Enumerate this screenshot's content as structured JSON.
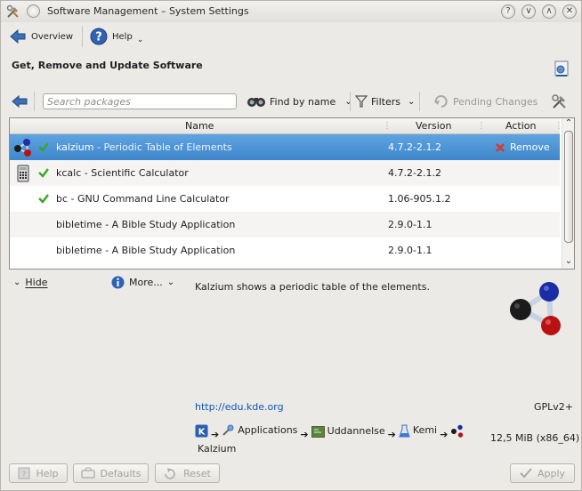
{
  "window": {
    "title": "Software Management – System Settings",
    "controls": [
      "?",
      "∨",
      "∧",
      "✕"
    ]
  },
  "toolbar": {
    "overview_label": "Overview",
    "help_label": "Help"
  },
  "heading": "Get, Remove and Update Software",
  "search": {
    "placeholder": "Search packages",
    "find_label": "Find by name",
    "filters_label": "Filters",
    "pending_label": "Pending Changes"
  },
  "table": {
    "columns": [
      "Name",
      "Version",
      "Action"
    ],
    "rows": [
      {
        "name": "kalzium",
        "summary": " - Periodic Table of Elements",
        "version": "4.7.2-2.1.2",
        "action": "Remove",
        "installed": true,
        "icon": "kalzium-icon",
        "selected": true
      },
      {
        "name": "kcalc",
        "summary": " - Scientific Calculator",
        "version": "4.7.2-2.1.2",
        "action": "",
        "installed": true,
        "icon": "calculator-icon",
        "selected": false
      },
      {
        "name": "bc",
        "summary": " - GNU Command Line Calculator",
        "version": "1.06-905.1.2",
        "action": "",
        "installed": true,
        "icon": "",
        "selected": false
      },
      {
        "name": "bibletime",
        "summary": " - A Bible Study Application",
        "version": "2.9.0-1.1",
        "action": "",
        "installed": false,
        "icon": "",
        "selected": false
      },
      {
        "name": "bibletime",
        "summary": " - A Bible Study Application",
        "version": "2.9.0-1.1",
        "action": "",
        "installed": false,
        "icon": "",
        "selected": false
      }
    ]
  },
  "details": {
    "hide_label": "Hide",
    "more_label": "More...",
    "description": "Kalzium shows a periodic table of the elements.",
    "homepage": "http://edu.kde.org",
    "license": "GPLv2+",
    "breadcrumb": [
      "Applications",
      "Uddannelse",
      "Kemi",
      "Kalzium"
    ],
    "size": "12,5 MiB (x86_64)"
  },
  "bottom": {
    "help_label": "Help",
    "defaults_label": "Defaults",
    "reset_label": "Reset",
    "apply_label": "Apply"
  },
  "colors": {
    "selection": "#4a90d9",
    "remove": "#d43a2a",
    "check": "#3aa52a",
    "link": "#0b57b5"
  }
}
